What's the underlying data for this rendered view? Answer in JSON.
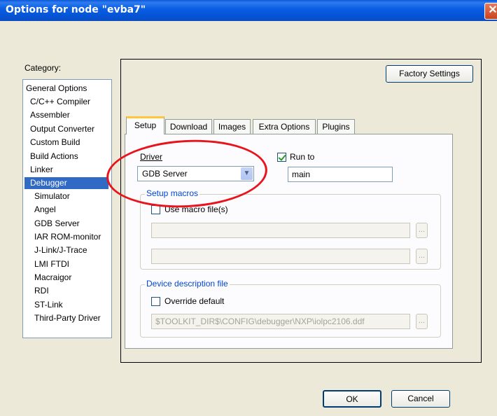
{
  "window": {
    "title": "Options for node \"evba7\"",
    "close_glyph": "✕"
  },
  "category": {
    "label": "Category:",
    "items": [
      {
        "label": "General Options"
      },
      {
        "label": "C/C++ Compiler"
      },
      {
        "label": "Assembler"
      },
      {
        "label": "Output Converter"
      },
      {
        "label": "Custom Build"
      },
      {
        "label": "Build Actions"
      },
      {
        "label": "Linker"
      },
      {
        "label": "Debugger"
      },
      {
        "label": "Simulator"
      },
      {
        "label": "Angel"
      },
      {
        "label": "GDB Server"
      },
      {
        "label": "IAR ROM-monitor"
      },
      {
        "label": "J-Link/J-Trace"
      },
      {
        "label": "LMI FTDI"
      },
      {
        "label": "Macraigor"
      },
      {
        "label": "RDI"
      },
      {
        "label": "ST-Link"
      },
      {
        "label": "Third-Party Driver"
      }
    ],
    "selected": "Debugger"
  },
  "factory_settings_label": "Factory Settings",
  "tabs": [
    {
      "label": "Setup"
    },
    {
      "label": "Download"
    },
    {
      "label": "Images"
    },
    {
      "label": "Extra Options"
    },
    {
      "label": "Plugins"
    }
  ],
  "active_tab": "Setup",
  "setup": {
    "driver_label": "Driver",
    "driver_value": "GDB Server",
    "run_to_label": "Run to",
    "run_to_checked": true,
    "run_to_value": "main",
    "setup_macros_label": "Setup macros",
    "use_macro_label": "Use macro file(s)",
    "use_macro_checked": false,
    "macro_file_1": "",
    "macro_file_2": "",
    "browse_glyph": "...",
    "device_desc_label": "Device description file",
    "override_label": "Override default",
    "override_checked": false,
    "device_file": "$TOOLKIT_DIR$\\CONFIG\\debugger\\NXP\\iolpc2106.ddf"
  },
  "ok_label": "OK",
  "cancel_label": "Cancel",
  "colors": {
    "titlebar": "#0a58d6",
    "selection": "#316ac5",
    "annotation": "#e8131b",
    "group_label": "#0046d5",
    "dialog_bg": "#ece9d8"
  }
}
